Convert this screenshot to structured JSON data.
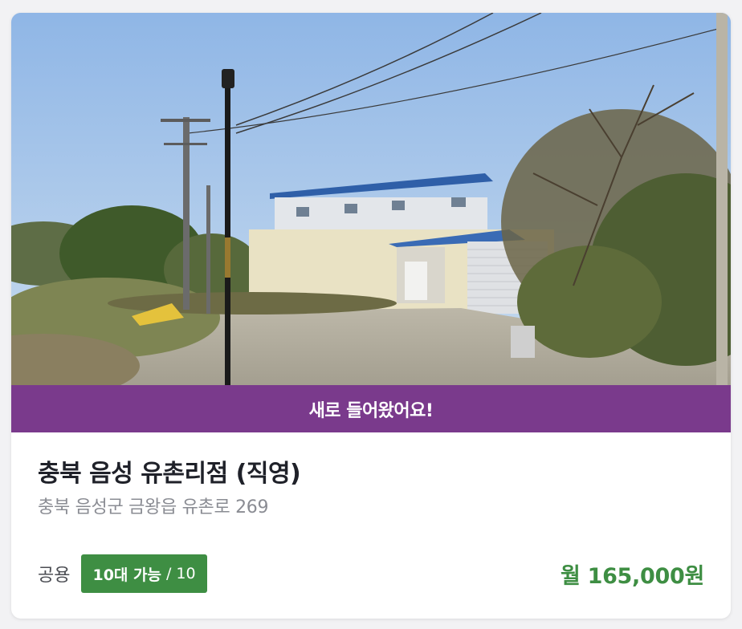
{
  "listing": {
    "banner_text": "새로 들어왔어요!",
    "title": "충북 음성 유촌리점 (직영)",
    "address": "충북 음성군 금왕읍 유촌로 269",
    "type_label": "공용",
    "availability": {
      "available_text": "10대 가능",
      "separator": "/",
      "total": "10"
    },
    "price": "월 165,000원"
  },
  "photo": {
    "description_icon": "parking-lot-photo"
  },
  "colors": {
    "banner": "#7a3a8c",
    "badge": "#3e8e43",
    "price": "#3e8e43"
  }
}
